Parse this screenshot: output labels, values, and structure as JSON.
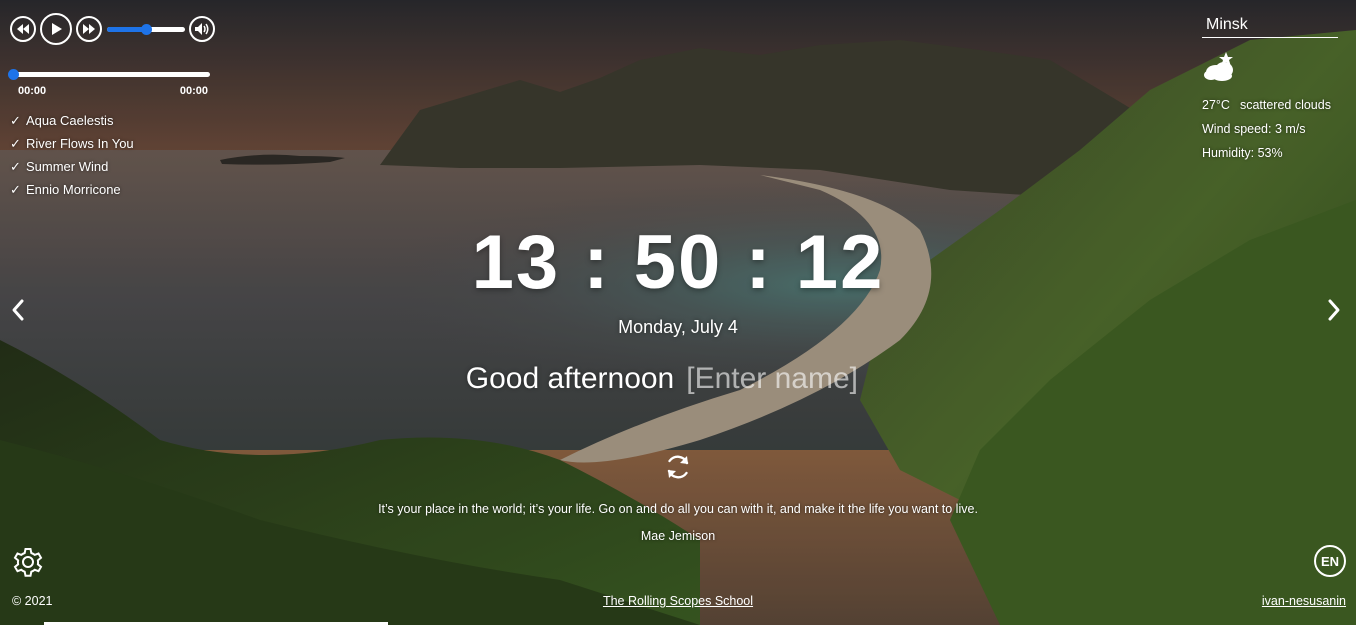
{
  "player": {
    "current_time": "00:00",
    "duration": "00:00",
    "volume_level": 0.5,
    "progress_level": 0,
    "playlist": [
      {
        "label": "Aqua Caelestis"
      },
      {
        "label": "River Flows In You"
      },
      {
        "label": "Summer Wind"
      },
      {
        "label": "Ennio Morricone"
      }
    ],
    "check_glyph": "✓",
    "accent_color": "#1e73e8",
    "icons": [
      "play-prev-icon",
      "play-icon",
      "play-next-icon",
      "volume-icon"
    ]
  },
  "weather": {
    "city": "Minsk",
    "temperature": "27°C",
    "description": "scattered clouds",
    "wind": "Wind speed: 3 m/s",
    "humidity": "Humidity: 53%",
    "icon": "scattered-clouds-icon"
  },
  "clock": {
    "time": "13 : 50 : 12",
    "date": "Monday, July 4"
  },
  "greeting": {
    "text": "Good afternoon",
    "name_placeholder": "[Enter name]",
    "name_value": ""
  },
  "quote": {
    "text": "It’s your place in the world; it’s your life. Go on and do all you can with it, and make it the life you want to live.",
    "author": "Mae Jemison",
    "refresh_icon": "refresh-icon"
  },
  "language": {
    "code": "EN"
  },
  "footer": {
    "copyright": "© 2021",
    "school_link": "The Rolling Scopes School",
    "github_link": "ivan-nesusanin"
  },
  "icons": {
    "slide_prev": "chevron-left-icon",
    "slide_next": "chevron-right-icon",
    "settings": "gear-icon"
  }
}
